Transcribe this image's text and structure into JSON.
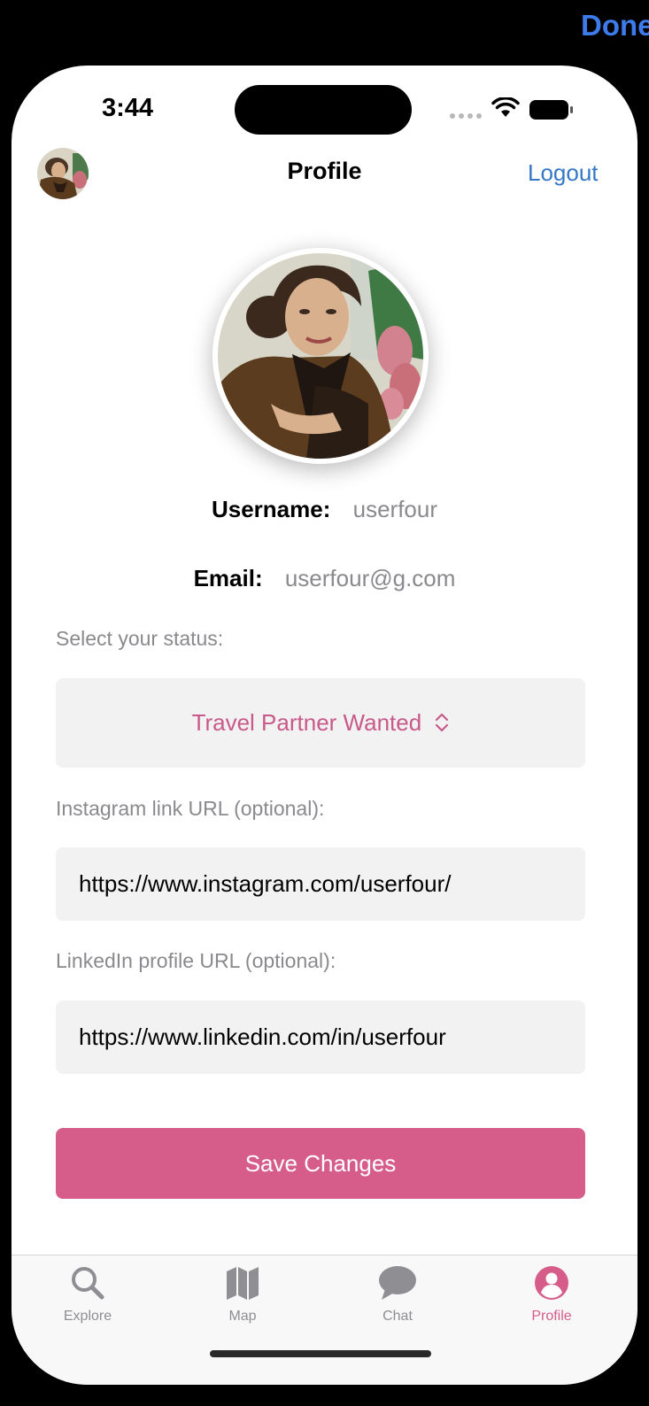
{
  "top_bar": {
    "done_label": "Done"
  },
  "status_bar": {
    "time": "3:44"
  },
  "nav": {
    "title": "Profile",
    "logout_label": "Logout"
  },
  "profile": {
    "username_label": "Username:",
    "username": "userfour",
    "email_label": "Email:",
    "email": "userfour@g.com"
  },
  "status": {
    "label": "Select your status:",
    "selected": "Travel Partner Wanted"
  },
  "instagram": {
    "label": "Instagram link URL (optional):",
    "value": "https://www.instagram.com/userfour/"
  },
  "linkedin": {
    "label": "LinkedIn profile URL (optional):",
    "value": "https://www.linkedin.com/in/userfour"
  },
  "save_label": "Save Changes",
  "tabs": [
    {
      "label": "Explore",
      "icon": "magnifier-icon",
      "active": false
    },
    {
      "label": "Map",
      "icon": "map-icon",
      "active": false
    },
    {
      "label": "Chat",
      "icon": "chat-bubble-icon",
      "active": false
    },
    {
      "label": "Profile",
      "icon": "person-circle-icon",
      "active": true
    }
  ],
  "colors": {
    "accent": "#d65c89",
    "link": "#3478c6",
    "done": "#3d7bea",
    "field_bg": "#f2f2f3",
    "muted_text": "#8a8a8e"
  }
}
